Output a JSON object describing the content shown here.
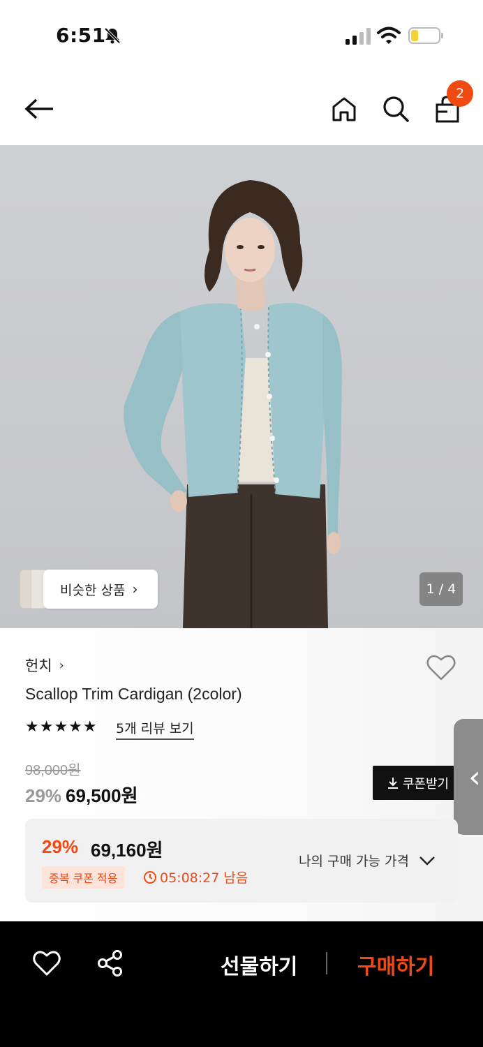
{
  "status": {
    "time": "6:51"
  },
  "nav": {
    "cart_count": "2"
  },
  "gallery": {
    "similar_label": "비슷한 상품",
    "page": "1 / 4",
    "current": 1,
    "total": 4
  },
  "product": {
    "brand": "헌치",
    "name": "Scallop Trim Cardigan (2color)",
    "rating_stars": "★★★★★",
    "rating": 5,
    "review_link": "5개 리뷰 보기",
    "original_price": "98,000원",
    "discount_pct": "29%",
    "price": "69,500원",
    "coupon_button": "쿠폰받기"
  },
  "my_price": {
    "discount_pct": "29%",
    "price": "69,160원",
    "badge": "중복 쿠폰 적용",
    "countdown": "05:08:27 남음",
    "toggle_label": "나의 구매 가능 가격"
  },
  "bottom": {
    "gift_label": "선물하기",
    "buy_label": "구매하기"
  },
  "colors": {
    "accent": "#f04a14",
    "dark": "#111111",
    "bottom_bar": "#000000"
  },
  "icons": {
    "back": "arrow-left-icon",
    "home": "home-icon",
    "search": "search-icon",
    "cart": "shopping-bag-icon",
    "wishlist": "heart-icon",
    "share": "share-icon",
    "download": "download-icon",
    "clock": "clock-icon",
    "chevron_down": "chevron-down-icon"
  }
}
